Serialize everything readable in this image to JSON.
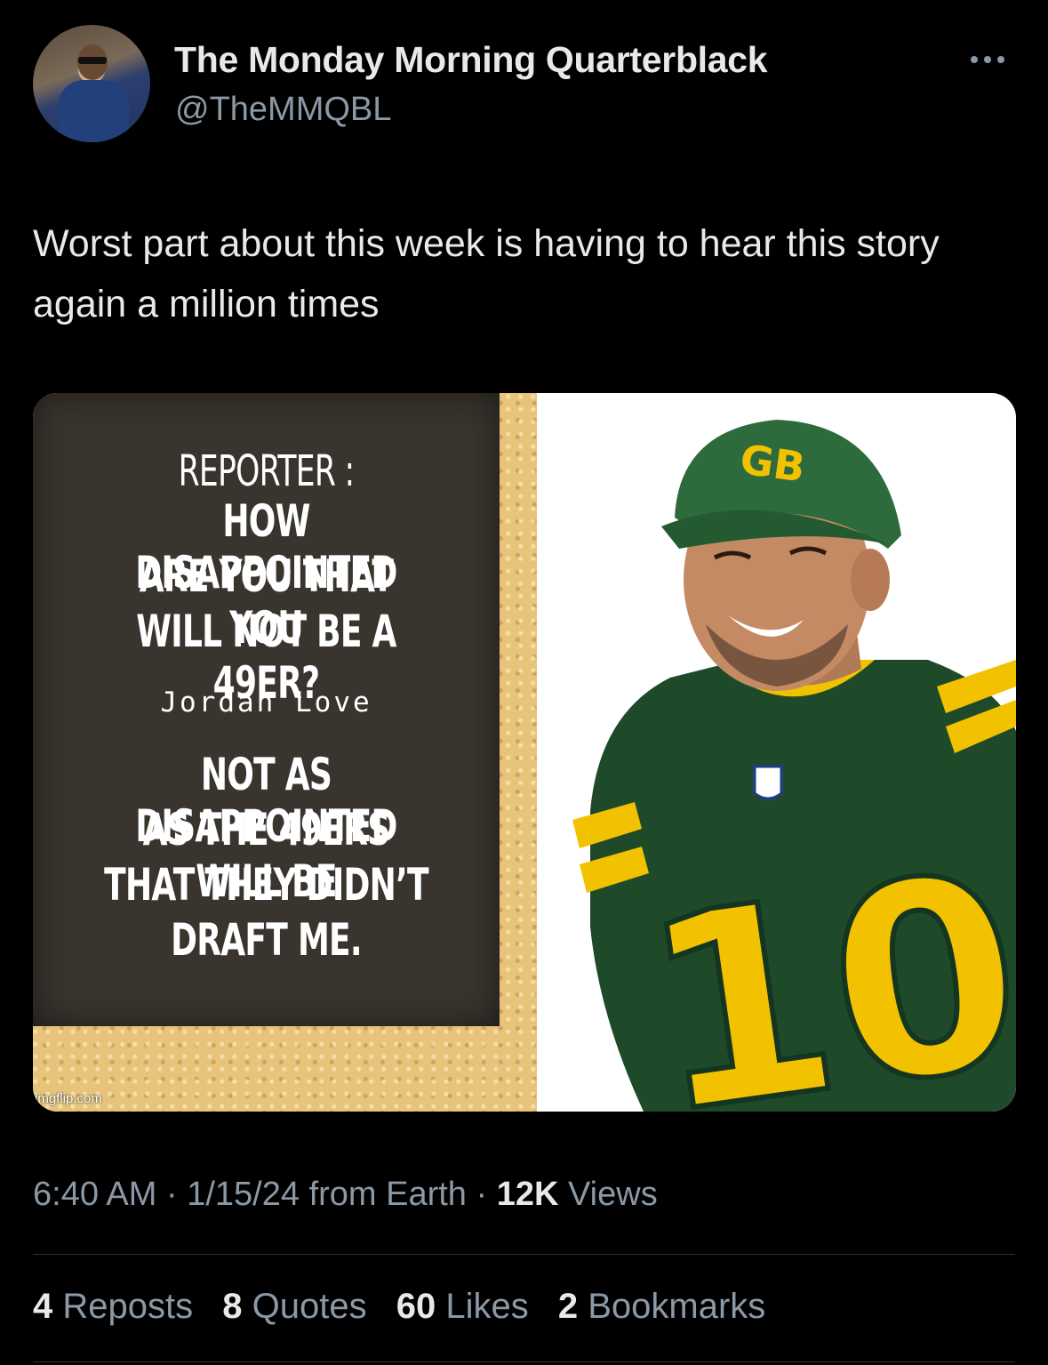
{
  "author": {
    "name": "The Monday Morning Quarterblack",
    "handle": "@TheMMQBL"
  },
  "tweet": {
    "text": "Worst part about this week is having to hear this story again a million times"
  },
  "media": {
    "meme": {
      "reporter_label": "REPORTER :",
      "question_lines": [
        "HOW DISAPPOINTED",
        "ARE YOU THAT YOU",
        "WILL NOT BE A 49ER?"
      ],
      "speaker": "Jordan Love",
      "answer_lines": [
        "NOT AS DISAPPOINTED",
        "AS THE 49ERS WILL BE",
        "THAT THEY DIDN’T",
        "DRAFT ME."
      ],
      "watermark": "imgflip.com"
    },
    "photo": {
      "cap_logo": "GB",
      "jersey_number": "10"
    }
  },
  "meta": {
    "time": "6:40 AM",
    "sep1": "·",
    "date": "1/15/24",
    "source": "from Earth",
    "sep2": "·",
    "views_count": "12K",
    "views_label": "Views"
  },
  "stats": [
    {
      "count": "4",
      "label": "Reposts"
    },
    {
      "count": "8",
      "label": "Quotes"
    },
    {
      "count": "60",
      "label": "Likes"
    },
    {
      "count": "2",
      "label": "Bookmarks"
    }
  ],
  "colors": {
    "background": "#000000",
    "text": "#e7e9ea",
    "secondary": "#8b98a5",
    "divider": "#2f3336",
    "jersey_green": "#1f4a2a",
    "jersey_gold": "#f2c200"
  }
}
